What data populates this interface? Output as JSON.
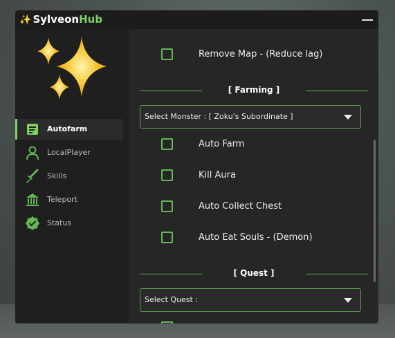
{
  "window": {
    "title_prefix": "Sylveon",
    "title_accent": "Hub",
    "title_icon": "sparkles-icon",
    "accent_color": "#7fd163",
    "minimize_icon": "minimize-icon"
  },
  "sidebar": {
    "logo": "sparkles-logo",
    "items": [
      {
        "label": "Autofarm",
        "icon": "document-icon",
        "active": true
      },
      {
        "label": "LocalPlayer",
        "icon": "user-icon",
        "active": false
      },
      {
        "label": "Skills",
        "icon": "sword-icon",
        "active": false
      },
      {
        "label": "Teleport",
        "icon": "bank-icon",
        "active": false
      },
      {
        "label": "Status",
        "icon": "check-badge-icon",
        "active": false
      }
    ]
  },
  "main": {
    "remove_map_label": "Remove Map - (Reduce lag)",
    "farming_header": "[ Farming ]",
    "monster_select": "Select Monster : [ Zoku's Subordinate ]",
    "farming_toggles": [
      "Auto Farm",
      "Kill Aura",
      "Auto Collect Chest",
      "Auto Eat Souls - (Demon)"
    ],
    "quest_header": "[ Quest ]",
    "quest_select": "Select Quest :"
  }
}
